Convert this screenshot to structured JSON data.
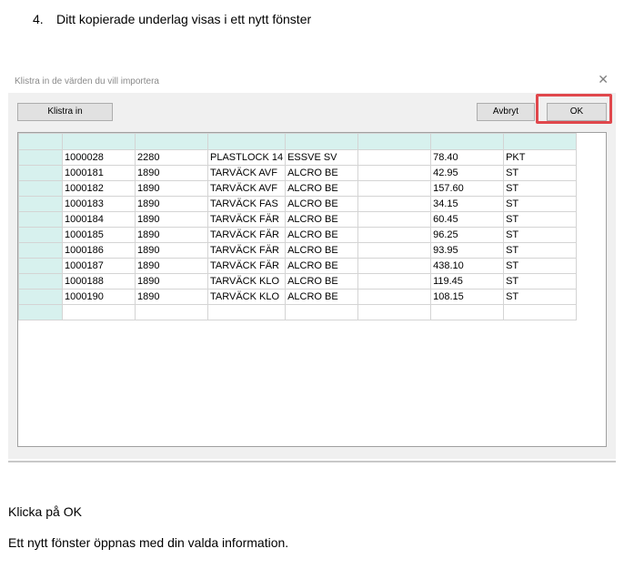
{
  "step": {
    "number": "4.",
    "text": "Ditt kopierade underlag visas i ett nytt fönster"
  },
  "dialog": {
    "title": "Klistra in de värden du vill importera",
    "close_symbol": "✕",
    "paste_button": "Klistra in",
    "cancel_button": "Avbryt",
    "ok_button": "OK"
  },
  "table": {
    "rows": [
      [
        "1000028",
        "2280",
        "PLASTLOCK 14",
        "ESSVE SV",
        "",
        "78.40",
        "PKT"
      ],
      [
        "1000181",
        "1890",
        "TARVÄCK AVF",
        "ALCRO BE",
        "",
        "42.95",
        "ST"
      ],
      [
        "1000182",
        "1890",
        "TARVÄCK AVF",
        "ALCRO BE",
        "",
        "157.60",
        "ST"
      ],
      [
        "1000183",
        "1890",
        "TARVÄCK FAS",
        "ALCRO BE",
        "",
        "34.15",
        "ST"
      ],
      [
        "1000184",
        "1890",
        "TARVÄCK FÄR",
        "ALCRO BE",
        "",
        "60.45",
        "ST"
      ],
      [
        "1000185",
        "1890",
        "TARVÄCK FÄR",
        "ALCRO BE",
        "",
        "96.25",
        "ST"
      ],
      [
        "1000186",
        "1890",
        "TARVÄCK FÄR",
        "ALCRO BE",
        "",
        "93.95",
        "ST"
      ],
      [
        "1000187",
        "1890",
        "TARVÄCK FÄR",
        "ALCRO BE",
        "",
        "438.10",
        "ST"
      ],
      [
        "1000188",
        "1890",
        "TARVÄCK KLO",
        "ALCRO BE",
        "",
        "119.45",
        "ST"
      ],
      [
        "1000190",
        "1890",
        "TARVÄCK KLO",
        "ALCRO BE",
        "",
        "108.15",
        "ST"
      ]
    ]
  },
  "instructions": {
    "line1": "Klicka på OK",
    "line2": "Ett nytt fönster öppnas med din valda information."
  },
  "colors": {
    "highlight": "#e0474c",
    "header_fill": "#d7f1ee"
  }
}
